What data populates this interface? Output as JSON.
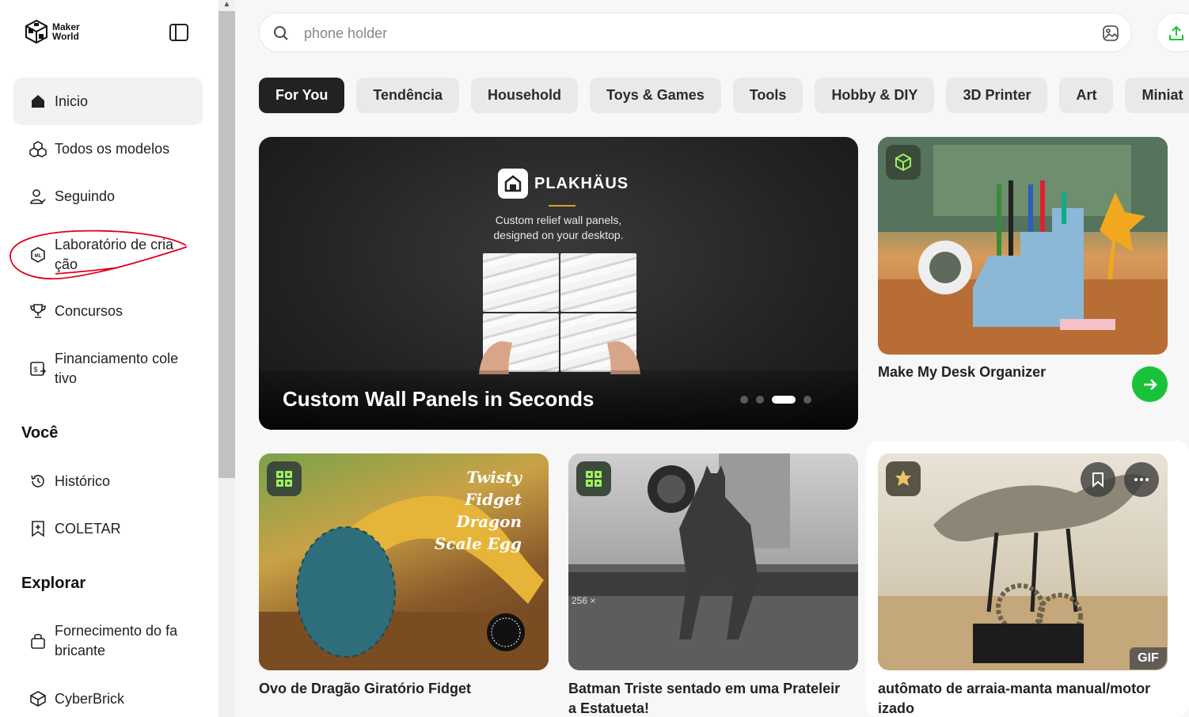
{
  "logo": {
    "line1": "Maker",
    "line2": "World"
  },
  "sidebar": {
    "items": [
      {
        "label": "Inicio",
        "icon": "home-icon",
        "active": true
      },
      {
        "label": "Todos os modelos",
        "icon": "cubes-icon"
      },
      {
        "label": "Seguindo",
        "icon": "user-follow-icon"
      },
      {
        "label": "Laboratório de cria\nção",
        "icon": "ml-lab-icon"
      },
      {
        "label": "Concursos",
        "icon": "trophy-icon"
      },
      {
        "label": "Financiamento cole\ntivo",
        "icon": "crowdfunding-icon"
      }
    ],
    "you_title": "Você",
    "you_items": [
      {
        "label": "Histórico",
        "icon": "history-icon"
      },
      {
        "label": "COLETAR",
        "icon": "collect-bookmark-icon"
      }
    ],
    "explore_title": "Explorar",
    "explore_items": [
      {
        "label": "Fornecimento do fa\nbricante",
        "icon": "shopping-bag-icon"
      },
      {
        "label": "CyberBrick",
        "icon": "cyberbrick-icon"
      }
    ]
  },
  "search": {
    "placeholder": "phone holder"
  },
  "tabs": [
    "For You",
    "Tendência",
    "Household",
    "Toys & Games",
    "Tools",
    "Hobby & DIY",
    "3D Printer",
    "Art",
    "Miniat"
  ],
  "hero": {
    "brand": "PLAKHÄUS",
    "subtitle_line1": "Custom relief wall panels,",
    "subtitle_line2": "designed on your desktop.",
    "title": "Custom Wall Panels in Seconds",
    "slide_count": 4,
    "active_slide": 3
  },
  "side_card": {
    "title": "Make My Desk Organizer"
  },
  "cards": [
    {
      "title": "Ovo de Dragão Giratório Fidget",
      "image_text_line1": "Twisty Fidget",
      "image_text_line2": "Dragon Scale Egg"
    },
    {
      "title": "Batman Triste sentado em uma Prateleir\na Estatueta!"
    },
    {
      "title": "autômato de arraia-manta manual/motor\nizado",
      "badge": "GIF"
    }
  ],
  "colors": {
    "accent_green": "#19c23a",
    "active_tab": "#222222",
    "annotation_red": "#e0001a"
  }
}
